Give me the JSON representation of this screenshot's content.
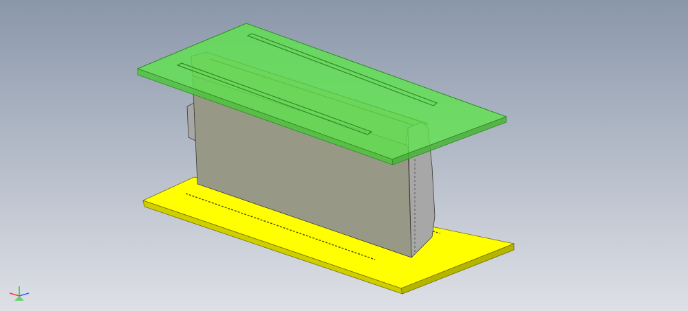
{
  "viewport": {
    "background_top": "#8a97aa",
    "background_bottom": "#dee0e6"
  },
  "model": {
    "parts": [
      {
        "name": "bottom-pcb",
        "color": "#ffff00"
      },
      {
        "name": "connector-body",
        "color": "#999985"
      },
      {
        "name": "top-pcb",
        "color": "#5ee64b",
        "opacity": 0.8
      }
    ]
  },
  "triad": {
    "x_color": "#ff3333",
    "y_color": "#33cc33",
    "z_color": "#3366ff"
  }
}
